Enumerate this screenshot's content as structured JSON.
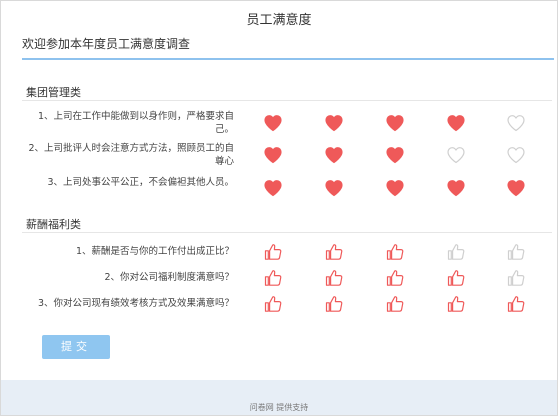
{
  "header": {
    "title": "员工满意度",
    "subtitle": "欢迎参加本年度员工满意度调查"
  },
  "sections": [
    {
      "title": "集团管理类",
      "icon": "heart-icon",
      "active_color": "#ef5959",
      "inactive_color": "#cfcfcf",
      "questions": [
        {
          "text": "1、上司在工作中能做到以身作则，严格要求自己。",
          "rating": 4,
          "max": 5
        },
        {
          "text": "2、上司批评人时会注意方式方法，照顾员工的自尊心",
          "rating": 3,
          "max": 5
        },
        {
          "text": "3、上司处事公平公正，不会偏袒其他人员。",
          "rating": 5,
          "max": 5
        }
      ]
    },
    {
      "title": "薪酬福利类",
      "icon": "thumbs-up-icon",
      "active_color": "#ef5959",
      "inactive_color": "#cfcfcf",
      "questions": [
        {
          "text": "1、薪酬是否与你的工作付出成正比？",
          "rating": 3,
          "max": 5
        },
        {
          "text": "2、你对公司福利制度满意吗？",
          "rating": 4,
          "max": 5
        },
        {
          "text": "3、你对公司现有绩效考核方式及效果满意吗？",
          "rating": 5,
          "max": 5
        }
      ]
    }
  ],
  "submit_label": "提交",
  "footer": {
    "text": "问卷网 提供支持"
  }
}
